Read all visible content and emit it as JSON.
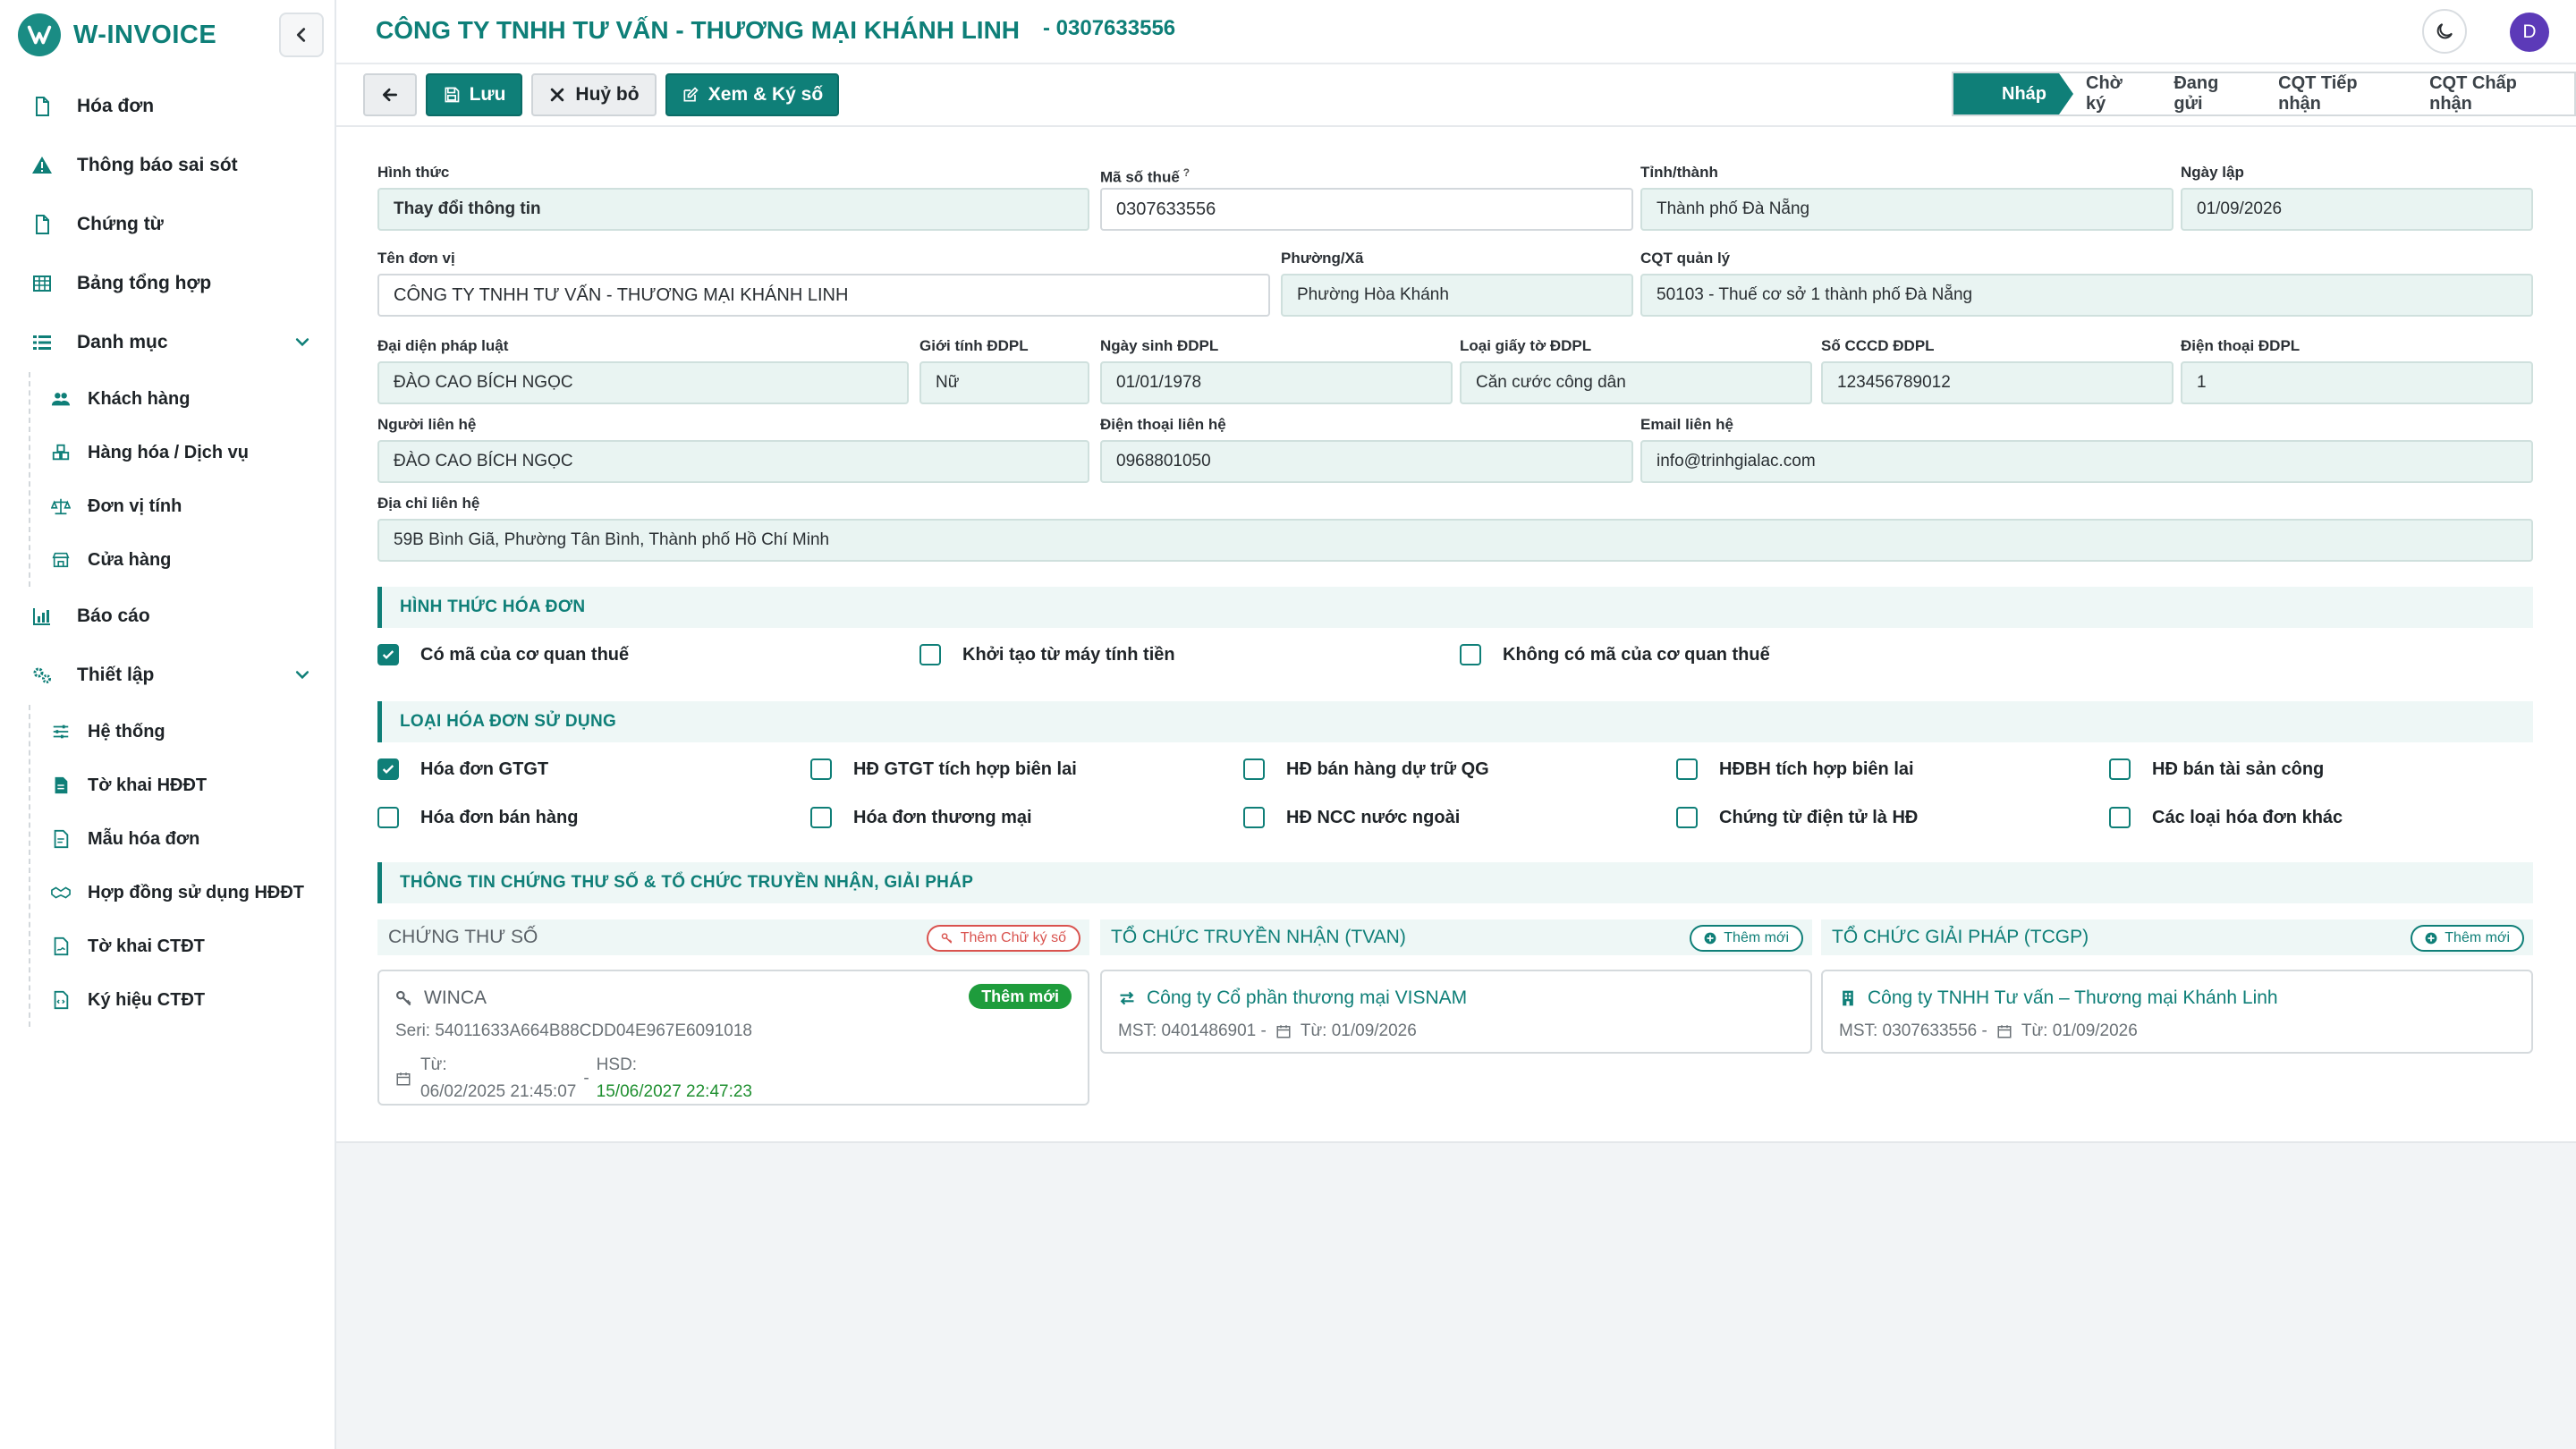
{
  "app": {
    "name": "W-INVOICE"
  },
  "sidebar": {
    "items": [
      {
        "label": "Hóa đơn"
      },
      {
        "label": "Thông báo sai sót"
      },
      {
        "label": "Chứng từ"
      },
      {
        "label": "Bảng tổng hợp"
      },
      {
        "label": "Danh mục"
      },
      {
        "label": "Báo cáo"
      },
      {
        "label": "Thiết lập"
      }
    ],
    "danh_muc_children": [
      {
        "label": "Khách hàng"
      },
      {
        "label": "Hàng hóa / Dịch vụ"
      },
      {
        "label": "Đơn vị tính"
      },
      {
        "label": "Cửa hàng"
      }
    ],
    "thiet_lap_children": [
      {
        "label": "Hệ thống"
      },
      {
        "label": "Tờ khai HĐĐT"
      },
      {
        "label": "Mẫu hóa đơn"
      },
      {
        "label": "Hợp đồng sử dụng HĐĐT"
      },
      {
        "label": "Tờ khai CTĐT"
      },
      {
        "label": "Ký hiệu CTĐT"
      }
    ]
  },
  "header": {
    "company": "CÔNG TY TNHH TƯ VẤN - THƯƠNG MẠI KHÁNH LINH",
    "taxcode": "- 0307633556",
    "avatar_initial": "D"
  },
  "toolbar": {
    "save_label": "Lưu",
    "cancel_label": "Huỷ bỏ",
    "sign_label": "Xem & Ký số"
  },
  "steps": [
    "Nháp",
    "Chờ ký",
    "Đang gửi",
    "CQT Tiếp nhận",
    "CQT Chấp nhận"
  ],
  "form": {
    "hinh_thuc": {
      "label": "Hình thức",
      "value": "Thay đổi thông tin"
    },
    "ma_so_thue": {
      "label": "Mã số thuế",
      "hint": "?",
      "value": "0307633556"
    },
    "tinh_thanh": {
      "label": "Tỉnh/thành",
      "value": "Thành phố Đà Nẵng"
    },
    "ngay_lap": {
      "label": "Ngày lập",
      "value": "01/09/2026"
    },
    "ten_don_vi": {
      "label": "Tên đơn vị",
      "value": "CÔNG TY TNHH TƯ VẤN - THƯƠNG MẠI KHÁNH LINH"
    },
    "phuong_xa": {
      "label": "Phường/Xã",
      "value": "Phường Hòa Khánh"
    },
    "cqt_quan_ly": {
      "label": "CQT quản lý",
      "value": "50103 - Thuế cơ sở 1 thành phố Đà Nẵng"
    },
    "dai_dien": {
      "label": "Đại diện pháp luật",
      "value": "ĐÀO CAO BÍCH NGỌC"
    },
    "gioi_tinh": {
      "label": "Giới tính ĐDPL",
      "value": "Nữ"
    },
    "ngay_sinh": {
      "label": "Ngày sinh ĐDPL",
      "value": "01/01/1978"
    },
    "loai_giay_to": {
      "label": "Loại giấy tờ ĐDPL",
      "value": "Căn cước công dân"
    },
    "so_cccd": {
      "label": "Số CCCD ĐDPL",
      "value": "123456789012"
    },
    "dien_thoai_ddpl": {
      "label": "Điện thoại ĐDPL",
      "value": "1"
    },
    "nguoi_lien_he": {
      "label": "Người liên hệ",
      "value": "ĐÀO CAO BÍCH NGỌC"
    },
    "dien_thoai_lh": {
      "label": "Điện thoại liên hệ",
      "value": "0968801050"
    },
    "email_lh": {
      "label": "Email liên hệ",
      "value": "info@trinhgialac.com"
    },
    "dia_chi": {
      "label": "Địa chỉ liên hệ",
      "value": "59B Bình Giã, Phường Tân Bình, Thành phố Hồ Chí Minh"
    }
  },
  "sections": {
    "hinh_thuc_hd": "HÌNH THỨC HÓA ĐƠN",
    "loai_hd": "LOẠI HÓA ĐƠN SỬ DỤNG",
    "thong_tin_cts": "THÔNG TIN CHỨNG THƯ SỐ & TỔ CHỨC TRUYỀN NHẬN, GIẢI PHÁP"
  },
  "hinh_thuc_options": [
    {
      "label": "Có mã của cơ quan thuế",
      "checked": true
    },
    {
      "label": "Khởi tạo từ máy tính tiền",
      "checked": false
    },
    {
      "label": "Không có mã của cơ quan thuế",
      "checked": false
    }
  ],
  "loai_hd_options": [
    {
      "label": "Hóa đơn GTGT",
      "checked": true
    },
    {
      "label": "HĐ GTGT tích hợp biên lai",
      "checked": false
    },
    {
      "label": "HĐ bán hàng dự trữ QG",
      "checked": false
    },
    {
      "label": "HĐBH tích hợp biên lai",
      "checked": false
    },
    {
      "label": "HĐ bán tài sản công",
      "checked": false
    },
    {
      "label": "Hóa đơn bán hàng",
      "checked": false
    },
    {
      "label": "Hóa đơn thương mại",
      "checked": false
    },
    {
      "label": "HĐ NCC nước ngoài",
      "checked": false
    },
    {
      "label": "Chứng từ điện tử là HĐ",
      "checked": false
    },
    {
      "label": "Các loại hóa đơn khác",
      "checked": false
    }
  ],
  "cts": {
    "heading": "CHỨNG THƯ SỐ",
    "add_label": "Thêm Chữ ký số",
    "card": {
      "name": "WINCA",
      "badge": "Thêm mới",
      "serial": "Seri: 54011633A664B88CDD04E967E6091018",
      "from_label": "Từ:",
      "from_value": "06/02/2025 21:45:07",
      "sep": "-",
      "to_label": "HSD:",
      "to_value": "15/06/2027 22:47:23"
    }
  },
  "tvan": {
    "heading": "TỔ CHỨC TRUYỀN NHẬN (TVAN)",
    "add_label": "Thêm mới",
    "card": {
      "name": "Công ty Cổ phần thương mại VISNAM",
      "mst": "MST: 0401486901 -",
      "date": "Từ: 01/09/2026"
    }
  },
  "tcgp": {
    "heading": "TỔ CHỨC GIẢI PHÁP (TCGP)",
    "add_label": "Thêm mới",
    "card": {
      "name": "Công ty TNHH Tư vấn – Thương mại Khánh Linh",
      "mst": "MST: 0307633556 -",
      "date": "Từ: 01/09/2026"
    }
  },
  "colors": {
    "primary": "#0f7f78",
    "danger": "#d9534f",
    "success": "#1e9c3c",
    "valid_date": "#1e8f2f"
  }
}
